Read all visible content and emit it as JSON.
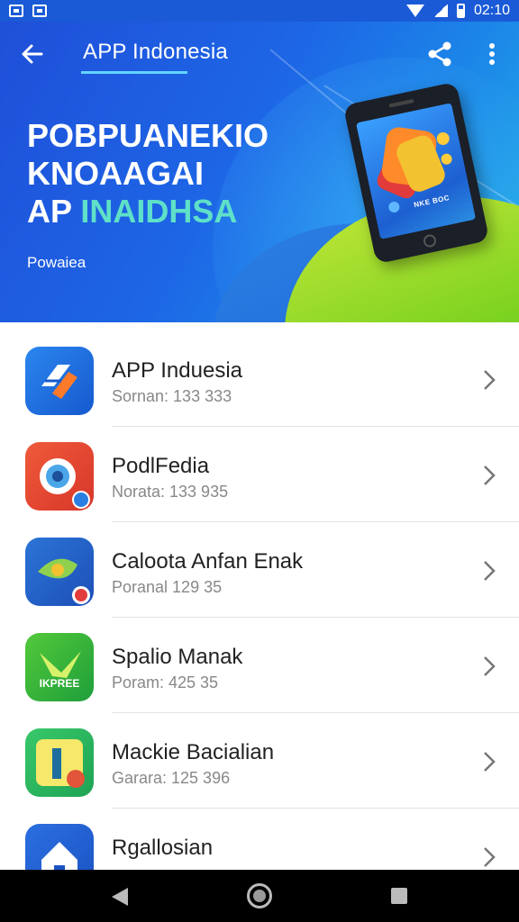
{
  "status_bar": {
    "time": "02:10"
  },
  "header": {
    "title": "APP Indonesia",
    "back_icon": "arrow-left-icon",
    "share_icon": "share-icon",
    "more_icon": "more-vert-icon"
  },
  "hero": {
    "line1": "POBPUANEKIO",
    "line2": "KNOAAGAI",
    "line3_prefix": "AP",
    "line3_accent": "INAIDHSA",
    "subtitle": "Powaiea",
    "phone_caption": "NKE BOC"
  },
  "apps": [
    {
      "name": "APP Induesia",
      "meta": "Sornan: 133 333",
      "icon": "app-indonesia-icon"
    },
    {
      "name": "PodlFedia",
      "meta": "Norata: 133 935",
      "icon": "podlfedia-icon"
    },
    {
      "name": "Caloota Anfan Enak",
      "meta": "Poranal 129 35",
      "icon": "caloota-icon"
    },
    {
      "name": "Spalio Manak",
      "meta": "Poram: 425 35",
      "icon": "spalio-icon"
    },
    {
      "name": "Mackie Bacialian",
      "meta": "Garara: 125 396",
      "icon": "mackie-icon"
    },
    {
      "name": "Rgallosian",
      "meta": "",
      "icon": "rgallosian-icon"
    }
  ],
  "icon_label_4": "IKPREE",
  "colors": {
    "header_blue": "#1d66e6",
    "accent_teal": "#5fe0c8",
    "title_underline": "#62d4ff"
  }
}
